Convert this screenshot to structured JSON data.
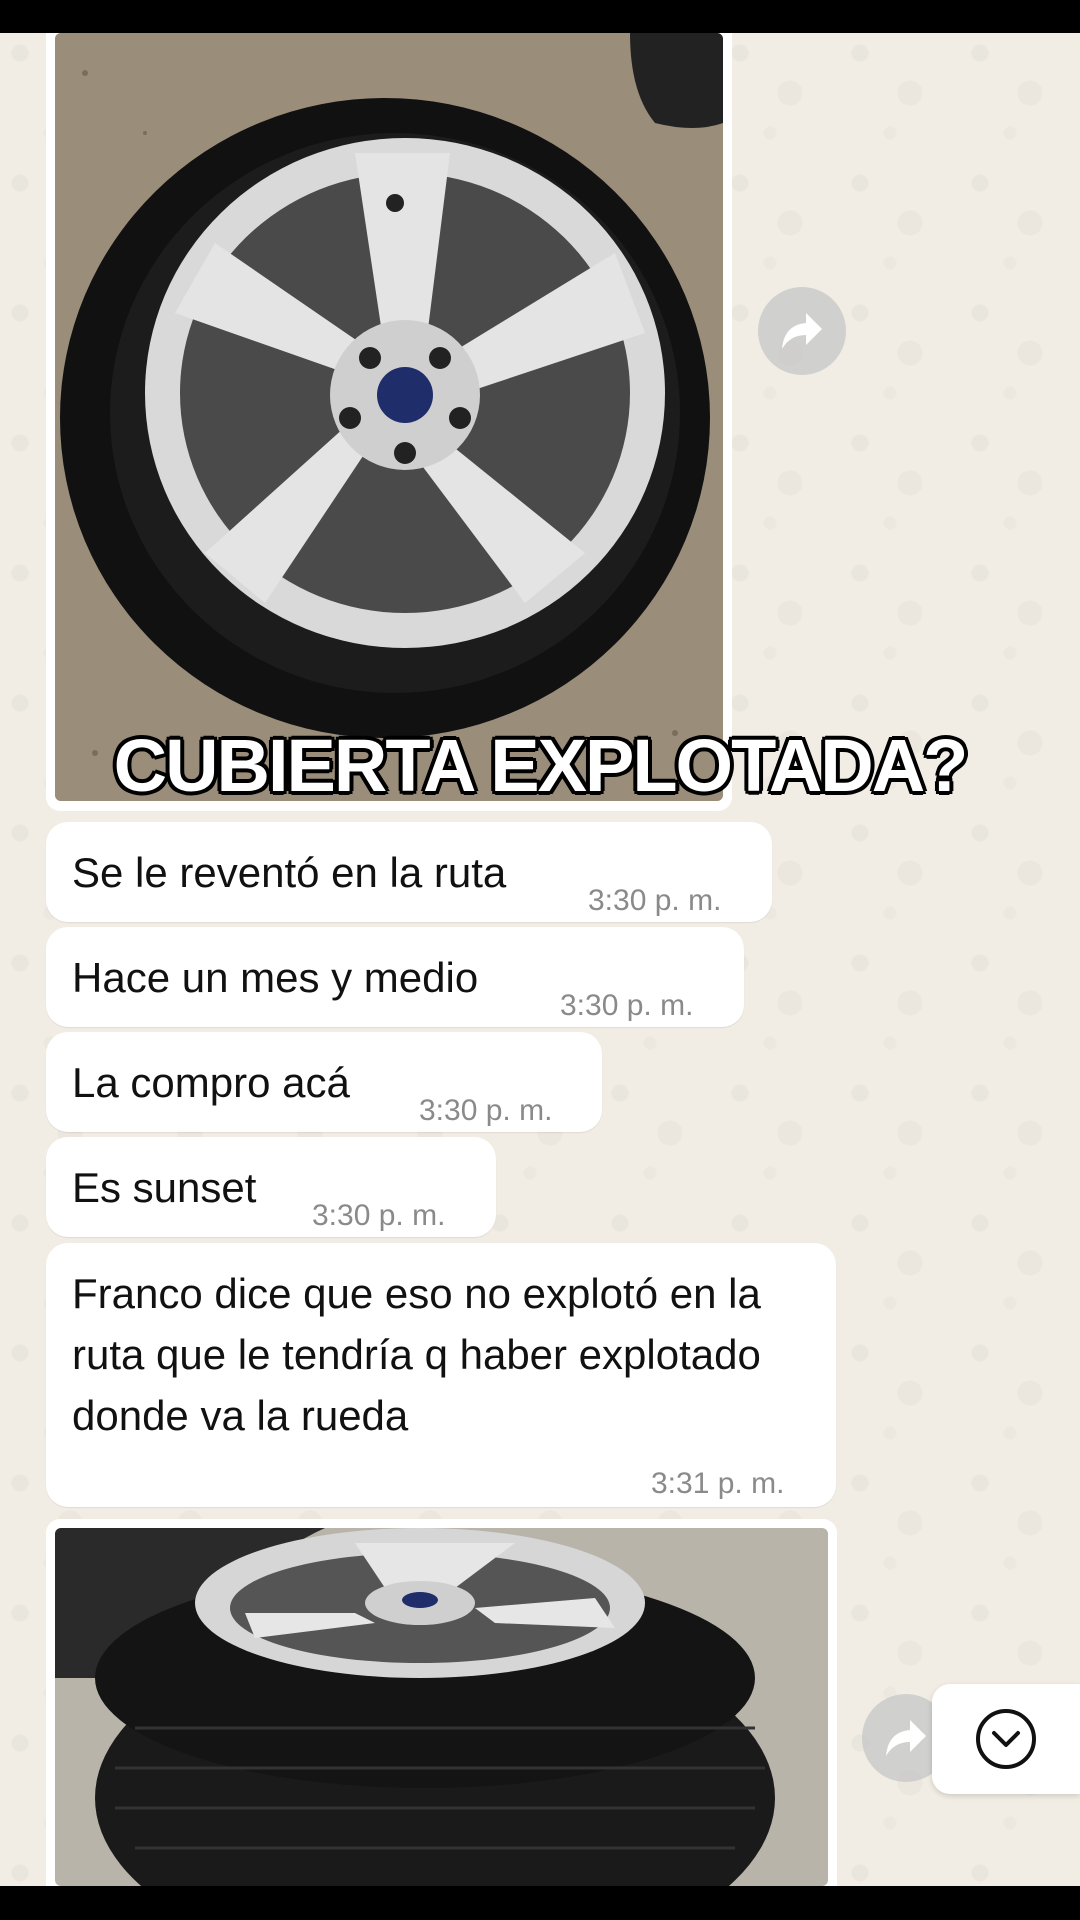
{
  "overlay": {
    "title": "CUBIERTA EXPLOTADA?"
  },
  "messages": [
    {
      "text": "Se le reventó en la ruta",
      "time": "3:30 p. m."
    },
    {
      "text": "Hace un mes y medio",
      "time": "3:30 p. m."
    },
    {
      "text": "La compro acá",
      "time": "3:30 p. m."
    },
    {
      "text": "Es sunset",
      "time": "3:30 p. m."
    },
    {
      "text": "Franco dice que eso no explotó en la ruta que le tendría q haber explotado donde va la rueda",
      "time": "3:31 p. m."
    }
  ],
  "icons": {
    "forward": "forward-arrow-icon",
    "scroll": "chevron-down-circle-icon"
  },
  "colors": {
    "chat_background": "#f1ede4",
    "bubble": "#ffffff",
    "timestamp": "#8a8a8a"
  }
}
